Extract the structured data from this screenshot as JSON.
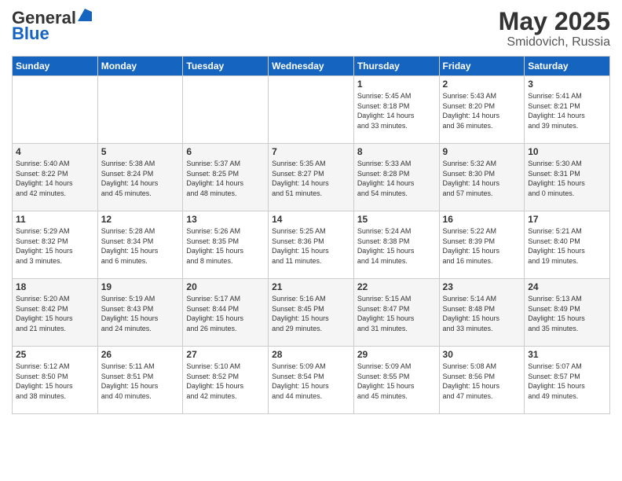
{
  "logo": {
    "general": "General",
    "blue": "Blue"
  },
  "header": {
    "month": "May 2025",
    "location": "Smidovich, Russia"
  },
  "weekdays": [
    "Sunday",
    "Monday",
    "Tuesday",
    "Wednesday",
    "Thursday",
    "Friday",
    "Saturday"
  ],
  "weeks": [
    [
      {
        "day": "",
        "info": ""
      },
      {
        "day": "",
        "info": ""
      },
      {
        "day": "",
        "info": ""
      },
      {
        "day": "",
        "info": ""
      },
      {
        "day": "1",
        "info": "Sunrise: 5:45 AM\nSunset: 8:18 PM\nDaylight: 14 hours\nand 33 minutes."
      },
      {
        "day": "2",
        "info": "Sunrise: 5:43 AM\nSunset: 8:20 PM\nDaylight: 14 hours\nand 36 minutes."
      },
      {
        "day": "3",
        "info": "Sunrise: 5:41 AM\nSunset: 8:21 PM\nDaylight: 14 hours\nand 39 minutes."
      }
    ],
    [
      {
        "day": "4",
        "info": "Sunrise: 5:40 AM\nSunset: 8:22 PM\nDaylight: 14 hours\nand 42 minutes."
      },
      {
        "day": "5",
        "info": "Sunrise: 5:38 AM\nSunset: 8:24 PM\nDaylight: 14 hours\nand 45 minutes."
      },
      {
        "day": "6",
        "info": "Sunrise: 5:37 AM\nSunset: 8:25 PM\nDaylight: 14 hours\nand 48 minutes."
      },
      {
        "day": "7",
        "info": "Sunrise: 5:35 AM\nSunset: 8:27 PM\nDaylight: 14 hours\nand 51 minutes."
      },
      {
        "day": "8",
        "info": "Sunrise: 5:33 AM\nSunset: 8:28 PM\nDaylight: 14 hours\nand 54 minutes."
      },
      {
        "day": "9",
        "info": "Sunrise: 5:32 AM\nSunset: 8:30 PM\nDaylight: 14 hours\nand 57 minutes."
      },
      {
        "day": "10",
        "info": "Sunrise: 5:30 AM\nSunset: 8:31 PM\nDaylight: 15 hours\nand 0 minutes."
      }
    ],
    [
      {
        "day": "11",
        "info": "Sunrise: 5:29 AM\nSunset: 8:32 PM\nDaylight: 15 hours\nand 3 minutes."
      },
      {
        "day": "12",
        "info": "Sunrise: 5:28 AM\nSunset: 8:34 PM\nDaylight: 15 hours\nand 6 minutes."
      },
      {
        "day": "13",
        "info": "Sunrise: 5:26 AM\nSunset: 8:35 PM\nDaylight: 15 hours\nand 8 minutes."
      },
      {
        "day": "14",
        "info": "Sunrise: 5:25 AM\nSunset: 8:36 PM\nDaylight: 15 hours\nand 11 minutes."
      },
      {
        "day": "15",
        "info": "Sunrise: 5:24 AM\nSunset: 8:38 PM\nDaylight: 15 hours\nand 14 minutes."
      },
      {
        "day": "16",
        "info": "Sunrise: 5:22 AM\nSunset: 8:39 PM\nDaylight: 15 hours\nand 16 minutes."
      },
      {
        "day": "17",
        "info": "Sunrise: 5:21 AM\nSunset: 8:40 PM\nDaylight: 15 hours\nand 19 minutes."
      }
    ],
    [
      {
        "day": "18",
        "info": "Sunrise: 5:20 AM\nSunset: 8:42 PM\nDaylight: 15 hours\nand 21 minutes."
      },
      {
        "day": "19",
        "info": "Sunrise: 5:19 AM\nSunset: 8:43 PM\nDaylight: 15 hours\nand 24 minutes."
      },
      {
        "day": "20",
        "info": "Sunrise: 5:17 AM\nSunset: 8:44 PM\nDaylight: 15 hours\nand 26 minutes."
      },
      {
        "day": "21",
        "info": "Sunrise: 5:16 AM\nSunset: 8:45 PM\nDaylight: 15 hours\nand 29 minutes."
      },
      {
        "day": "22",
        "info": "Sunrise: 5:15 AM\nSunset: 8:47 PM\nDaylight: 15 hours\nand 31 minutes."
      },
      {
        "day": "23",
        "info": "Sunrise: 5:14 AM\nSunset: 8:48 PM\nDaylight: 15 hours\nand 33 minutes."
      },
      {
        "day": "24",
        "info": "Sunrise: 5:13 AM\nSunset: 8:49 PM\nDaylight: 15 hours\nand 35 minutes."
      }
    ],
    [
      {
        "day": "25",
        "info": "Sunrise: 5:12 AM\nSunset: 8:50 PM\nDaylight: 15 hours\nand 38 minutes."
      },
      {
        "day": "26",
        "info": "Sunrise: 5:11 AM\nSunset: 8:51 PM\nDaylight: 15 hours\nand 40 minutes."
      },
      {
        "day": "27",
        "info": "Sunrise: 5:10 AM\nSunset: 8:52 PM\nDaylight: 15 hours\nand 42 minutes."
      },
      {
        "day": "28",
        "info": "Sunrise: 5:09 AM\nSunset: 8:54 PM\nDaylight: 15 hours\nand 44 minutes."
      },
      {
        "day": "29",
        "info": "Sunrise: 5:09 AM\nSunset: 8:55 PM\nDaylight: 15 hours\nand 45 minutes."
      },
      {
        "day": "30",
        "info": "Sunrise: 5:08 AM\nSunset: 8:56 PM\nDaylight: 15 hours\nand 47 minutes."
      },
      {
        "day": "31",
        "info": "Sunrise: 5:07 AM\nSunset: 8:57 PM\nDaylight: 15 hours\nand 49 minutes."
      }
    ]
  ]
}
